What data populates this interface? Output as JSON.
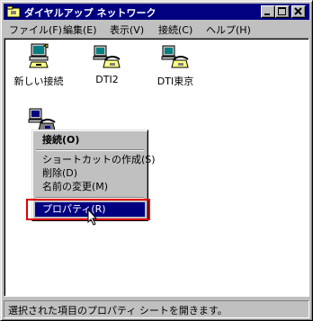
{
  "window": {
    "title": "ダイヤルアップ ネットワーク"
  },
  "menubar": [
    "ファイル(F)",
    "編集(E)",
    "表示(V)",
    "接続(C)",
    "ヘルプ(H)"
  ],
  "icons": [
    {
      "label": "新しい接続",
      "icon": "new-connection-icon"
    },
    {
      "label": "DTI2",
      "icon": "dialup-connection-icon"
    },
    {
      "label": "DTI東京",
      "icon": "dialup-connection-icon"
    }
  ],
  "context_menu": {
    "connect": "接続(O)",
    "create_shortcut": "ショートカットの作成(S)",
    "delete": "削除(D)",
    "rename": "名前の変更(M)",
    "properties": "プロパティ(R)"
  },
  "status": "選択された項目のプロパティ シートを開きます。",
  "colors": {
    "titlebar": "#000080",
    "highlight": "#e00000",
    "face": "#c0c0c0"
  }
}
